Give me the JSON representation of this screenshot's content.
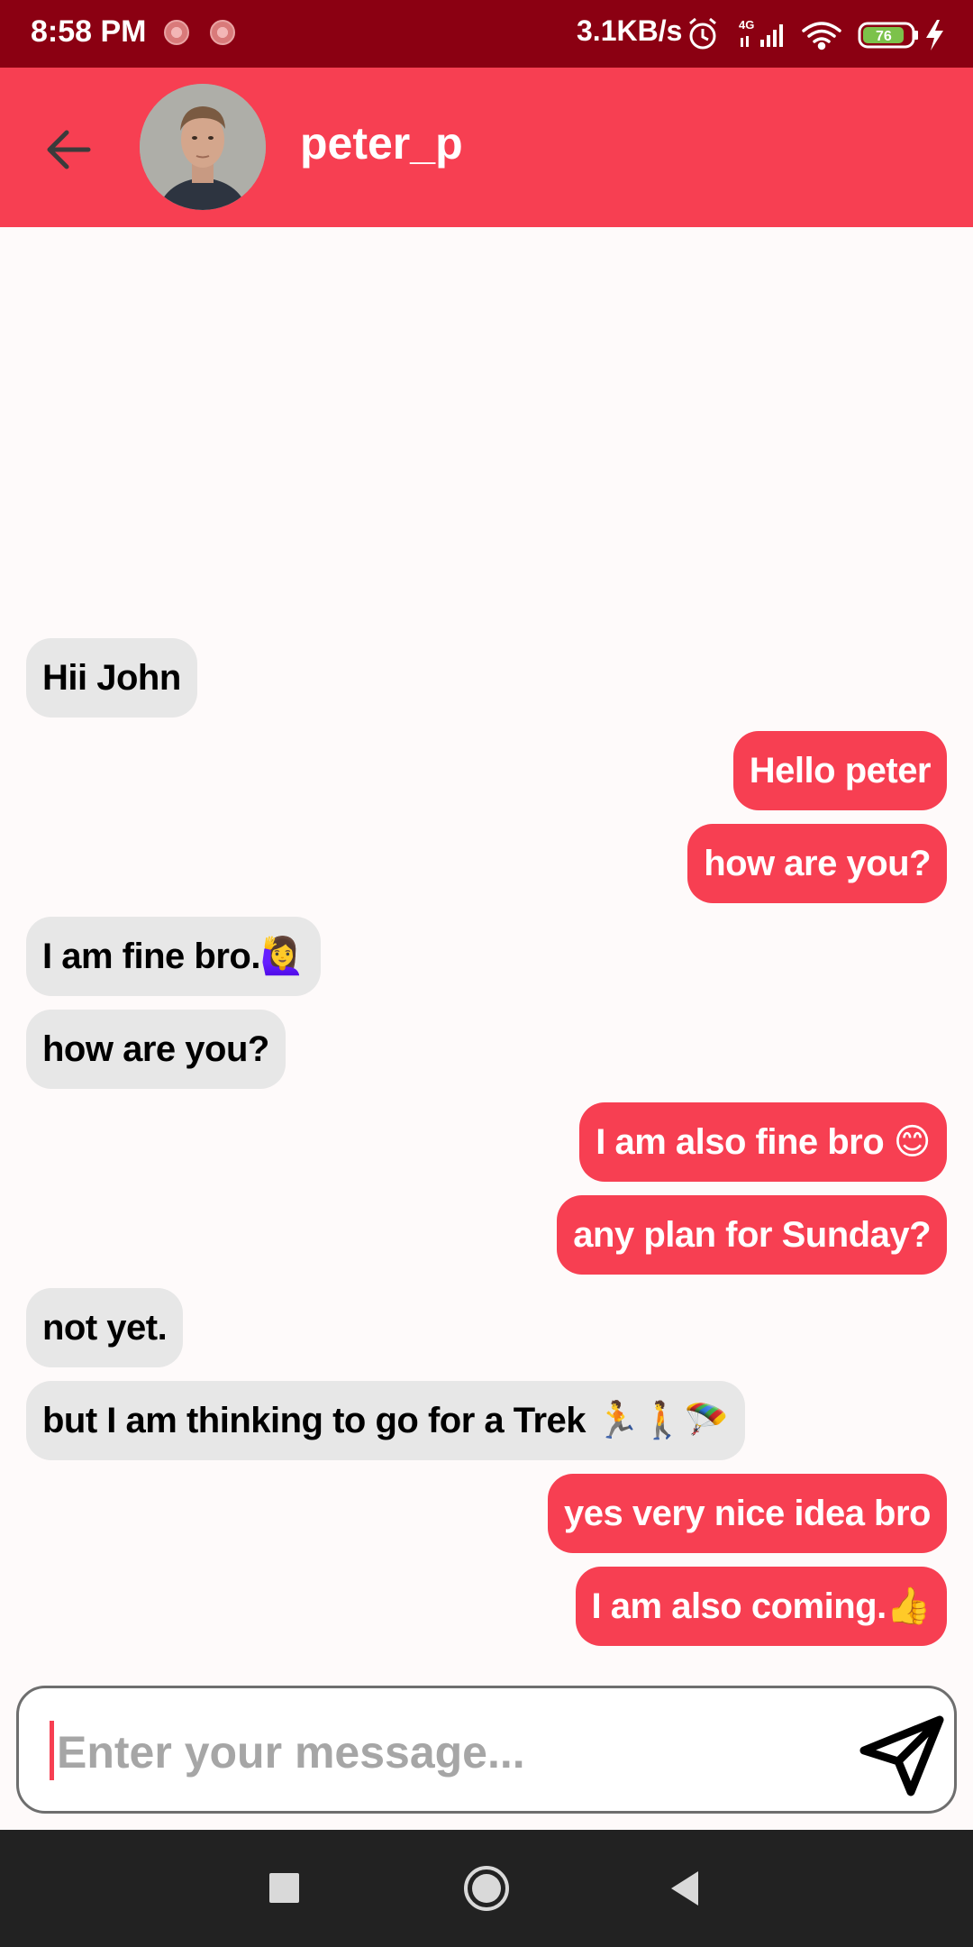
{
  "status_bar": {
    "time": "8:58 PM",
    "network_speed": "3.1KB/s",
    "network_type": "4G",
    "battery": "76",
    "icons": [
      "notification-icon",
      "notification-icon",
      "alarm-icon",
      "signal-icon",
      "wifi-icon",
      "battery-icon",
      "charging-icon"
    ]
  },
  "header": {
    "contact_name": "peter_p",
    "back_icon": "arrow-left-icon"
  },
  "messages": [
    {
      "text": "Hii John",
      "direction": "in"
    },
    {
      "text": "Hello peter",
      "direction": "out"
    },
    {
      "text": "how are you?",
      "direction": "out"
    },
    {
      "text": "I am fine bro.🙋‍♀️",
      "direction": "in"
    },
    {
      "text": "how are you?",
      "direction": "in"
    },
    {
      "text": "I am also fine bro 😊",
      "direction": "out"
    },
    {
      "text": "any plan for Sunday?",
      "direction": "out"
    },
    {
      "text": "not yet.",
      "direction": "in"
    },
    {
      "text": "but I am thinking to go for a Trek 🏃🚶🪂",
      "direction": "in"
    },
    {
      "text": "yes very nice idea bro",
      "direction": "out"
    },
    {
      "text": "I am also coming.👍",
      "direction": "out"
    }
  ],
  "composer": {
    "placeholder": "Enter your message...",
    "value": "",
    "send_icon": "send-icon"
  },
  "nav_bar": {
    "icons": [
      "recents-square-icon",
      "home-circle-icon",
      "back-triangle-icon"
    ]
  },
  "colors": {
    "status_bar": "#8b0012",
    "accent": "#f73f52",
    "incoming_bubble": "#e7e7e7",
    "nav_bar": "#222222"
  }
}
